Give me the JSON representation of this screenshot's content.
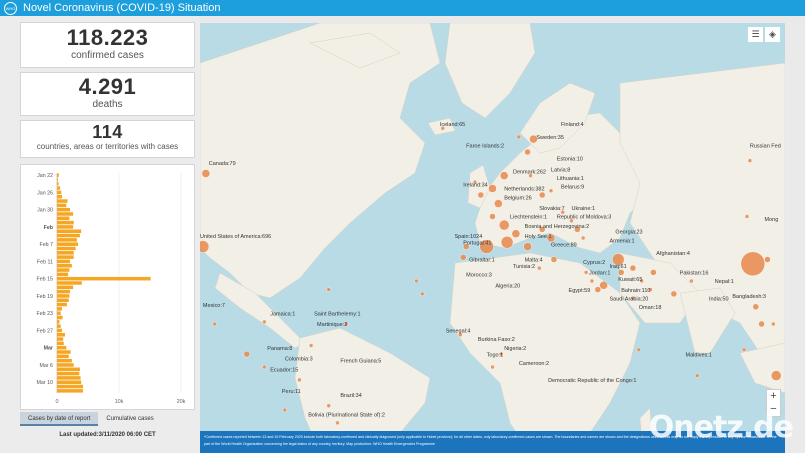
{
  "header": {
    "logo": "WHO",
    "title": "Novel Coronavirus (COVID-19) Situation"
  },
  "stats": {
    "confirmed": {
      "value": "118.223",
      "label": "confirmed cases"
    },
    "deaths": {
      "value": "4.291",
      "label": "deaths"
    },
    "countries": {
      "value": "114",
      "label": "countries, areas or territories with cases"
    }
  },
  "chart_data": {
    "type": "bar",
    "orientation": "horizontal",
    "categories": [
      "Jan 22",
      "",
      "",
      "",
      "Jan 26",
      "",
      "",
      "",
      "Jan 30",
      "",
      "",
      "",
      "Feb",
      "",
      "",
      "",
      "Feb 7",
      "",
      "",
      "",
      "Feb 11",
      "",
      "",
      "",
      "Feb 15",
      "",
      "",
      "",
      "Feb 19",
      "",
      "",
      "",
      "Feb 23",
      "",
      "",
      "",
      "Feb 27",
      "",
      "",
      "",
      "Mar",
      "",
      "",
      "",
      "Mar 6",
      "",
      "",
      "",
      "Mar 10"
    ],
    "values": [
      300,
      150,
      250,
      500,
      700,
      800,
      1700,
      1500,
      2100,
      2600,
      2000,
      2700,
      2600,
      3900,
      3700,
      3200,
      3400,
      3000,
      2700,
      2700,
      2100,
      2400,
      2000,
      1800,
      15100,
      4000,
      2600,
      2100,
      2000,
      1900,
      1600,
      800,
      600,
      900,
      400,
      600,
      800,
      1300,
      1000,
      1100,
      1500,
      2200,
      1900,
      2400,
      2700,
      3700,
      3600,
      3800,
      3900,
      4200,
      4200
    ],
    "xticks": [
      "0",
      "10k",
      "20k"
    ],
    "xlim": [
      0,
      20000
    ],
    "color": "#f5a623"
  },
  "tabs": [
    "Cases by date of report",
    "Cumulative cases"
  ],
  "last_updated": "Last updated:3/11/2020 06:00 CET",
  "map": {
    "labels": [
      {
        "text": "Canada:79",
        "lx": 0.015,
        "ly": 0.33
      },
      {
        "text": "United States of America:696",
        "lx": 0.0,
        "ly": 0.5
      },
      {
        "text": "Mexico:7",
        "lx": 0.005,
        "ly": 0.66
      },
      {
        "text": "Iceland:65",
        "lx": 0.41,
        "ly": 0.24
      },
      {
        "text": "Faroe Islands:2",
        "lx": 0.455,
        "ly": 0.29
      },
      {
        "text": "Sweden:35",
        "lx": 0.575,
        "ly": 0.27
      },
      {
        "text": "Finland:4",
        "lx": 0.617,
        "ly": 0.24
      },
      {
        "text": "Estonia:10",
        "lx": 0.61,
        "ly": 0.32
      },
      {
        "text": "Latvia:8",
        "lx": 0.6,
        "ly": 0.345
      },
      {
        "text": "Lithuania:1",
        "lx": 0.61,
        "ly": 0.365
      },
      {
        "text": "Belarus:9",
        "lx": 0.617,
        "ly": 0.385
      },
      {
        "text": "Denmark:262",
        "lx": 0.535,
        "ly": 0.35
      },
      {
        "text": "Netherlands:382",
        "lx": 0.52,
        "ly": 0.39
      },
      {
        "text": "Belgium:26",
        "lx": 0.52,
        "ly": 0.41
      },
      {
        "text": "Ireland:34",
        "lx": 0.45,
        "ly": 0.38
      },
      {
        "text": "Slovakia:7",
        "lx": 0.58,
        "ly": 0.435
      },
      {
        "text": "Ukraine:1",
        "lx": 0.635,
        "ly": 0.435
      },
      {
        "text": "Liechtenstein:1",
        "lx": 0.53,
        "ly": 0.455
      },
      {
        "text": "Republic of Moldova:3",
        "lx": 0.61,
        "ly": 0.455
      },
      {
        "text": "Bosnia and Herzegovina:2",
        "lx": 0.555,
        "ly": 0.477
      },
      {
        "text": "Georgia:23",
        "lx": 0.71,
        "ly": 0.49
      },
      {
        "text": "Armenia:1",
        "lx": 0.7,
        "ly": 0.51
      },
      {
        "text": "Spain:1024",
        "lx": 0.435,
        "ly": 0.5
      },
      {
        "text": "Portugal:41",
        "lx": 0.45,
        "ly": 0.515
      },
      {
        "text": "Holy See:1",
        "lx": 0.555,
        "ly": 0.5
      },
      {
        "text": "Greece:89",
        "lx": 0.6,
        "ly": 0.52
      },
      {
        "text": "Gibraltar:1",
        "lx": 0.46,
        "ly": 0.555
      },
      {
        "text": "Tunisia:2",
        "lx": 0.535,
        "ly": 0.57
      },
      {
        "text": "Malta:4",
        "lx": 0.555,
        "ly": 0.555
      },
      {
        "text": "Morocco:3",
        "lx": 0.455,
        "ly": 0.59
      },
      {
        "text": "Algeria:20",
        "lx": 0.505,
        "ly": 0.615
      },
      {
        "text": "Cyprus:2",
        "lx": 0.655,
        "ly": 0.56
      },
      {
        "text": "Jordan:1",
        "lx": 0.665,
        "ly": 0.585
      },
      {
        "text": "Iraq:61",
        "lx": 0.7,
        "ly": 0.57
      },
      {
        "text": "Kuwait:65",
        "lx": 0.715,
        "ly": 0.6
      },
      {
        "text": "Egypt:59",
        "lx": 0.63,
        "ly": 0.625
      },
      {
        "text": "Bahrain:110",
        "lx": 0.72,
        "ly": 0.625
      },
      {
        "text": "Saudi Arabia:20",
        "lx": 0.7,
        "ly": 0.645
      },
      {
        "text": "Oman:18",
        "lx": 0.75,
        "ly": 0.665
      },
      {
        "text": "Afghanistan:4",
        "lx": 0.78,
        "ly": 0.54
      },
      {
        "text": "Pakistan:16",
        "lx": 0.82,
        "ly": 0.585
      },
      {
        "text": "Nepal:1",
        "lx": 0.88,
        "ly": 0.605
      },
      {
        "text": "India:50",
        "lx": 0.87,
        "ly": 0.645
      },
      {
        "text": "Bangladesh:3",
        "lx": 0.91,
        "ly": 0.64
      },
      {
        "text": "Maldives:1",
        "lx": 0.83,
        "ly": 0.775
      },
      {
        "text": "Senegal:4",
        "lx": 0.42,
        "ly": 0.72
      },
      {
        "text": "Burkina Faso:2",
        "lx": 0.475,
        "ly": 0.74
      },
      {
        "text": "Togo:1",
        "lx": 0.49,
        "ly": 0.775
      },
      {
        "text": "Nigeria:2",
        "lx": 0.52,
        "ly": 0.76
      },
      {
        "text": "Cameroon:2",
        "lx": 0.545,
        "ly": 0.795
      },
      {
        "text": "Democratic Republic of the Congo:1",
        "lx": 0.595,
        "ly": 0.835
      },
      {
        "text": "Saint Barthelemy:1",
        "lx": 0.195,
        "ly": 0.68
      },
      {
        "text": "Martinique:2",
        "lx": 0.2,
        "ly": 0.705
      },
      {
        "text": "Jamaica:1",
        "lx": 0.12,
        "ly": 0.68
      },
      {
        "text": "Panama:8",
        "lx": 0.115,
        "ly": 0.76
      },
      {
        "text": "Colombia:3",
        "lx": 0.145,
        "ly": 0.785
      },
      {
        "text": "French Guiana:5",
        "lx": 0.24,
        "ly": 0.79
      },
      {
        "text": "Ecuador:15",
        "lx": 0.12,
        "ly": 0.81
      },
      {
        "text": "Peru:11",
        "lx": 0.14,
        "ly": 0.86
      },
      {
        "text": "Brazil:34",
        "lx": 0.24,
        "ly": 0.87
      },
      {
        "text": "Bolivia (Plurinational State of):2",
        "lx": 0.185,
        "ly": 0.915
      },
      {
        "text": "Russian Fed",
        "lx": 0.94,
        "ly": 0.29
      },
      {
        "text": "Mong",
        "lx": 0.965,
        "ly": 0.46
      }
    ],
    "footnote": "*Confirmed cases reported between 13 and 19 February 2020 include both laboratory-confirmed and clinically diagnosed (only applicable to Hubei province); for all other dates, only laboratory-confirmed cases are shown. The boundaries and names are shown and the designations used on this map do not imply the expression of any opinion whatsoever on the part of the World Health Organization concerning the legal status of any country, territory. Map production: WHO Health Emergencies Programme",
    "watermark": "Onetz.de"
  }
}
